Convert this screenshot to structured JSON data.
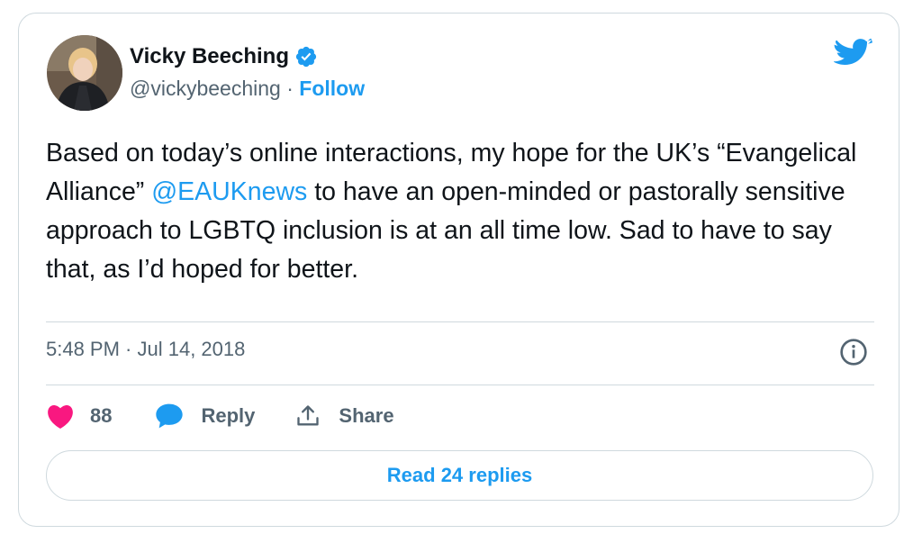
{
  "tweet": {
    "author_name": "Vicky Beeching",
    "handle": "@vickybeeching",
    "handle_separator": " · ",
    "follow_label": "Follow",
    "text_part1": "Based on today’s online interactions, my hope for the UK’s “Evangelical Alliance” ",
    "mention": "@EAUKnews",
    "text_part2": " to have an open-minded or pastorally sensitive approach to LGBTQ inclusion is at an all time low. Sad to have to say that, as I’d hoped for better.",
    "timestamp": "5:48 PM · Jul 14, 2018",
    "like_count": "88",
    "reply_label": "Reply",
    "share_label": "Share",
    "read_replies_label": "Read 24 replies"
  },
  "colors": {
    "accent": "#1d9bf0",
    "like": "#f91880",
    "muted": "#536471",
    "border": "#cfd9de"
  },
  "icons": {
    "brand": "twitter-bird-icon",
    "verified": "verified-badge-icon",
    "info": "info-icon",
    "like": "heart-icon",
    "reply": "speech-bubble-icon",
    "share": "share-upload-icon"
  }
}
